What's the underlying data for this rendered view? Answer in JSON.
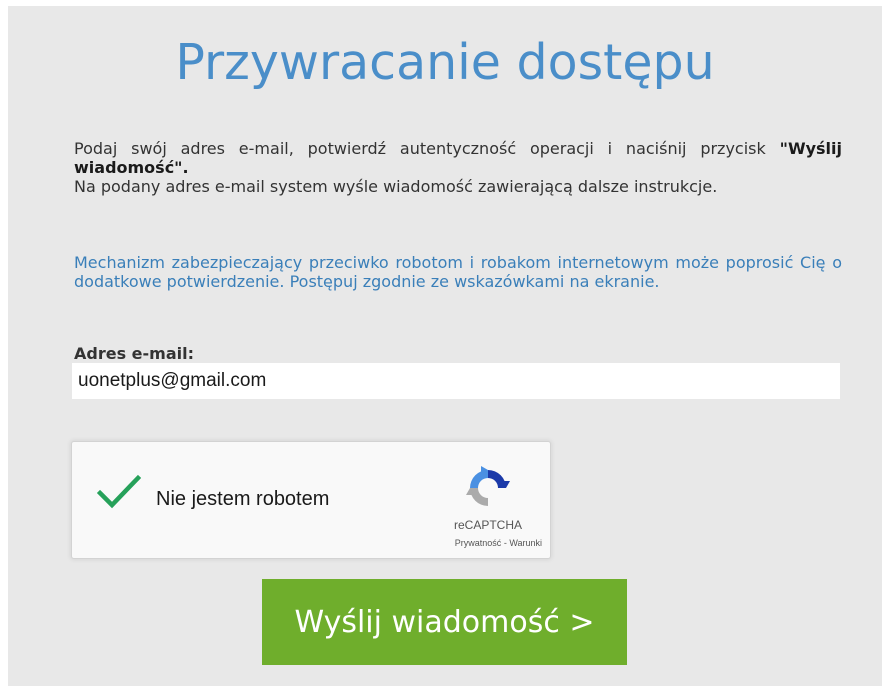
{
  "page": {
    "title": "Przywracanie dostępu"
  },
  "instructions": {
    "line1_prefix": "Podaj swój adres e-mail, potwierdź autentyczność operacji i naciśnij przycisk ",
    "button_ref": "\"Wyślij wiadomość\".",
    "line2": "Na podany adres e-mail system wyśle wiadomość zawierającą dalsze instrukcje."
  },
  "captcha_note": "Mechanizm zabezpieczający przeciwko robotom i robakom internetowym może poprosić Cię o dodatkowe potwierdzenie. Postępuj zgodnie ze wskazówkami na ekranie.",
  "form": {
    "email_label": "Adres e-mail:",
    "email_value": "uonetplus@gmail.com"
  },
  "recaptcha": {
    "checked": true,
    "label": "Nie jestem robotem",
    "brand": "reCAPTCHA",
    "privacy_link": "Prywatność",
    "separator": " - ",
    "terms_link": "Warunki"
  },
  "submit": {
    "label": "Wyślij wiadomość >"
  },
  "colors": {
    "panel_background": "#e8e8e8",
    "title": "#4a8ec9",
    "note": "#3a7fb9",
    "button": "#6fae2c",
    "checkmark": "#26a15a"
  }
}
